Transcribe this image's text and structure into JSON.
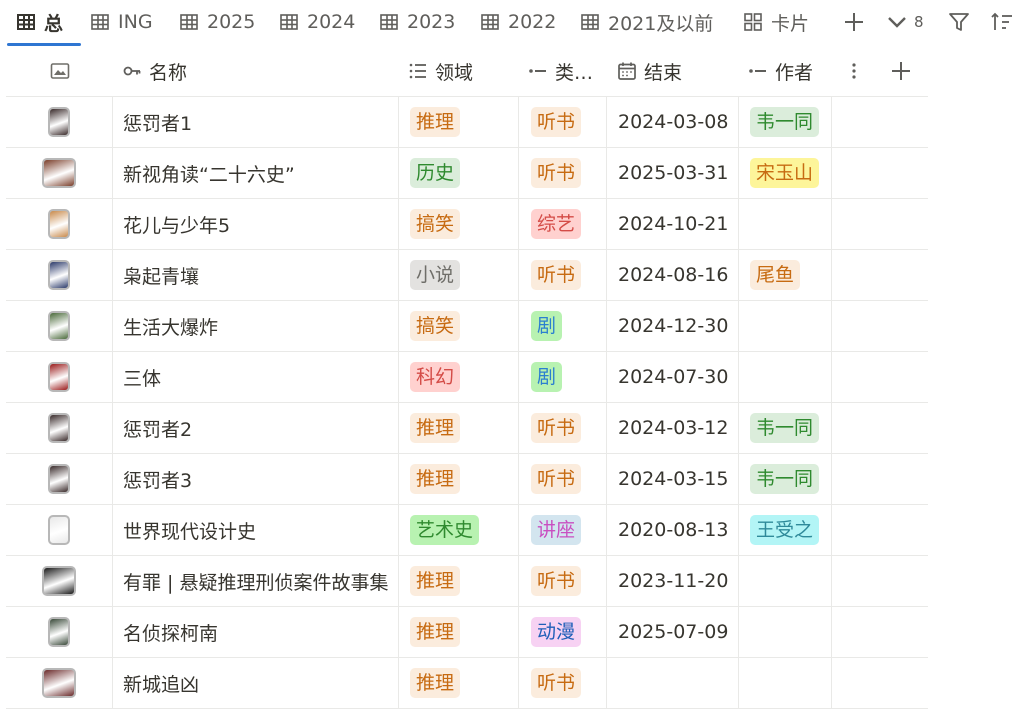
{
  "tabs": [
    {
      "label": "总",
      "icon": "table-icon",
      "active": true
    },
    {
      "label": "ING",
      "icon": "table-icon"
    },
    {
      "label": "2025",
      "icon": "table-icon"
    },
    {
      "label": "2024",
      "icon": "table-icon"
    },
    {
      "label": "2023",
      "icon": "table-icon"
    },
    {
      "label": "2022",
      "icon": "table-icon"
    },
    {
      "label": "2021及以前",
      "icon": "table-icon"
    },
    {
      "label": "卡片",
      "icon": "gallery-icon"
    }
  ],
  "toolbar": {
    "add_view_icon": "plus-icon",
    "more_views_count": "8",
    "filter_icon": "filter-icon",
    "sort_icon": "sort-icon"
  },
  "columns": {
    "image_icon": "image-icon",
    "name": "名称",
    "domain": "领域",
    "type": "类…",
    "end": "结束",
    "author": "作者"
  },
  "tag_colors": {
    "orange": {
      "bg": "#fbecdd",
      "fg": "#c76b12"
    },
    "green": {
      "bg": "#dbeddb",
      "fg": "#2f8a2f"
    },
    "gray": {
      "bg": "#e3e2e0",
      "fg": "#6f6e69"
    },
    "red": {
      "bg": "#ffd1cf",
      "fg": "#d44c47"
    },
    "brightgreen": {
      "bg": "#b8f2b1",
      "fg": "#2b7fd0"
    },
    "blue": {
      "bg": "#d3e5ef",
      "fg": "#c94fc1"
    },
    "pink": {
      "bg": "#f7d2f3",
      "fg": "#1f5fb8"
    },
    "lime": {
      "bg": "#b8f2b1",
      "fg": "#2f8a2f"
    },
    "yellow": {
      "bg": "#fdf59a",
      "fg": "#c76b12"
    },
    "cyan": {
      "bg": "#b3f5f6",
      "fg": "#2f8a9a"
    },
    "salmon": {
      "bg": "#ffd1cf",
      "fg": "#c76b12"
    }
  },
  "rows": [
    {
      "name": "惩罚者1",
      "domain": {
        "text": "推理",
        "color": "orange"
      },
      "type": {
        "text": "听书",
        "color": "orange"
      },
      "end": "2024-03-08",
      "author": {
        "text": "韦一同",
        "color": "green"
      },
      "thumb": "#3a2b2b"
    },
    {
      "name": "新视角读“二十六史”",
      "domain": {
        "text": "历史",
        "color": "green"
      },
      "type": {
        "text": "听书",
        "color": "orange"
      },
      "end": "2025-03-31",
      "author": {
        "text": "宋玉山",
        "color": "yellow"
      },
      "thumb": "#7a3e2a",
      "wide": true
    },
    {
      "name": "花儿与少年5",
      "domain": {
        "text": "搞笑",
        "color": "orange"
      },
      "type": {
        "text": "综艺",
        "color": "red"
      },
      "end": "2024-10-21",
      "author": null,
      "thumb": "#c98a4b"
    },
    {
      "name": "枭起青壤",
      "domain": {
        "text": "小说",
        "color": "gray"
      },
      "type": {
        "text": "听书",
        "color": "orange"
      },
      "end": "2024-08-16",
      "author": {
        "text": "尾鱼",
        "color": "orange"
      },
      "thumb": "#2b3a6a"
    },
    {
      "name": "生活大爆炸",
      "domain": {
        "text": "搞笑",
        "color": "orange"
      },
      "type": {
        "text": "剧",
        "color": "brightgreen"
      },
      "end": "2024-12-30",
      "author": null,
      "thumb": "#4a6a3a"
    },
    {
      "name": "三体",
      "domain": {
        "text": "科幻",
        "color": "red"
      },
      "type": {
        "text": "剧",
        "color": "brightgreen"
      },
      "end": "2024-07-30",
      "author": null,
      "thumb": "#9a1a1a"
    },
    {
      "name": "惩罚者2",
      "domain": {
        "text": "推理",
        "color": "orange"
      },
      "type": {
        "text": "听书",
        "color": "orange"
      },
      "end": "2024-03-12",
      "author": {
        "text": "韦一同",
        "color": "green"
      },
      "thumb": "#3a2b2b"
    },
    {
      "name": "惩罚者3",
      "domain": {
        "text": "推理",
        "color": "orange"
      },
      "type": {
        "text": "听书",
        "color": "orange"
      },
      "end": "2024-03-15",
      "author": {
        "text": "韦一同",
        "color": "green"
      },
      "thumb": "#3a2b2b"
    },
    {
      "name": "世界现代设计史",
      "domain": {
        "text": "艺术史",
        "color": "lime"
      },
      "type": {
        "text": "讲座",
        "color": "blue"
      },
      "end": "2020-08-13",
      "author": {
        "text": "王受之",
        "color": "cyan"
      },
      "thumb": "#e8e8e8"
    },
    {
      "name": "有罪 | 悬疑推理刑侦案件故事集",
      "domain": {
        "text": "推理",
        "color": "orange"
      },
      "type": {
        "text": "听书",
        "color": "orange"
      },
      "end": "2023-11-20",
      "author": null,
      "thumb": "#1a1a1a",
      "wide": true
    },
    {
      "name": "名侦探柯南",
      "domain": {
        "text": "推理",
        "color": "orange"
      },
      "type": {
        "text": "动漫",
        "color": "pink"
      },
      "end": "2025-07-09",
      "author": null,
      "thumb": "#3a4a3a"
    },
    {
      "name": "新城追凶",
      "domain": {
        "text": "推理",
        "color": "orange"
      },
      "type": {
        "text": "听书",
        "color": "orange"
      },
      "end": "",
      "author": null,
      "thumb": "#6a2a2a",
      "wide": true
    }
  ]
}
